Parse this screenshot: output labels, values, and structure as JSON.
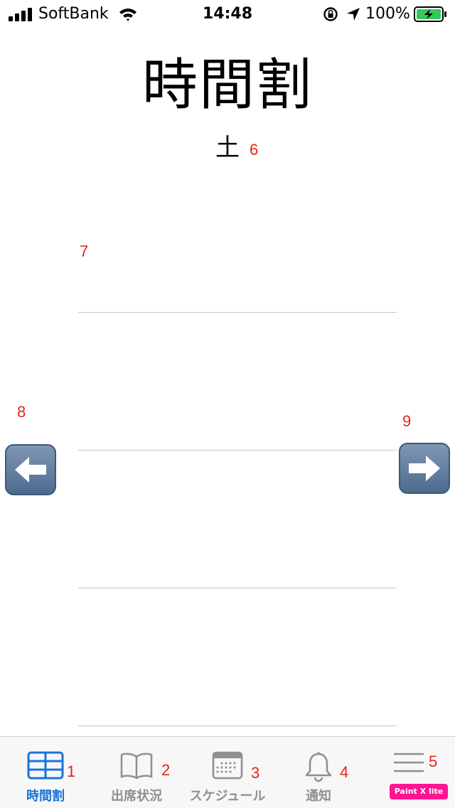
{
  "status_bar": {
    "carrier": "SoftBank",
    "time": "14:48",
    "battery_percent": "100%"
  },
  "header": {
    "title": "時間割",
    "day": "土"
  },
  "annotations": [
    "1",
    "2",
    "3",
    "4",
    "5",
    "6",
    "7",
    "8",
    "9"
  ],
  "tabs": [
    {
      "label": "時間割",
      "icon": "grid-icon",
      "active": true
    },
    {
      "label": "出席状況",
      "icon": "book-icon",
      "active": false
    },
    {
      "label": "スケジュール",
      "icon": "calendar-icon",
      "active": false
    },
    {
      "label": "通知",
      "icon": "bell-icon",
      "active": false
    },
    {
      "label": "",
      "icon": "menu-icon",
      "active": false
    }
  ],
  "watermark": "Paint X lite",
  "colors": {
    "accent": "#1a73d9",
    "inactive": "#8e8e93",
    "annotation": "#e0261b",
    "arrow_button": "#5b789c"
  }
}
